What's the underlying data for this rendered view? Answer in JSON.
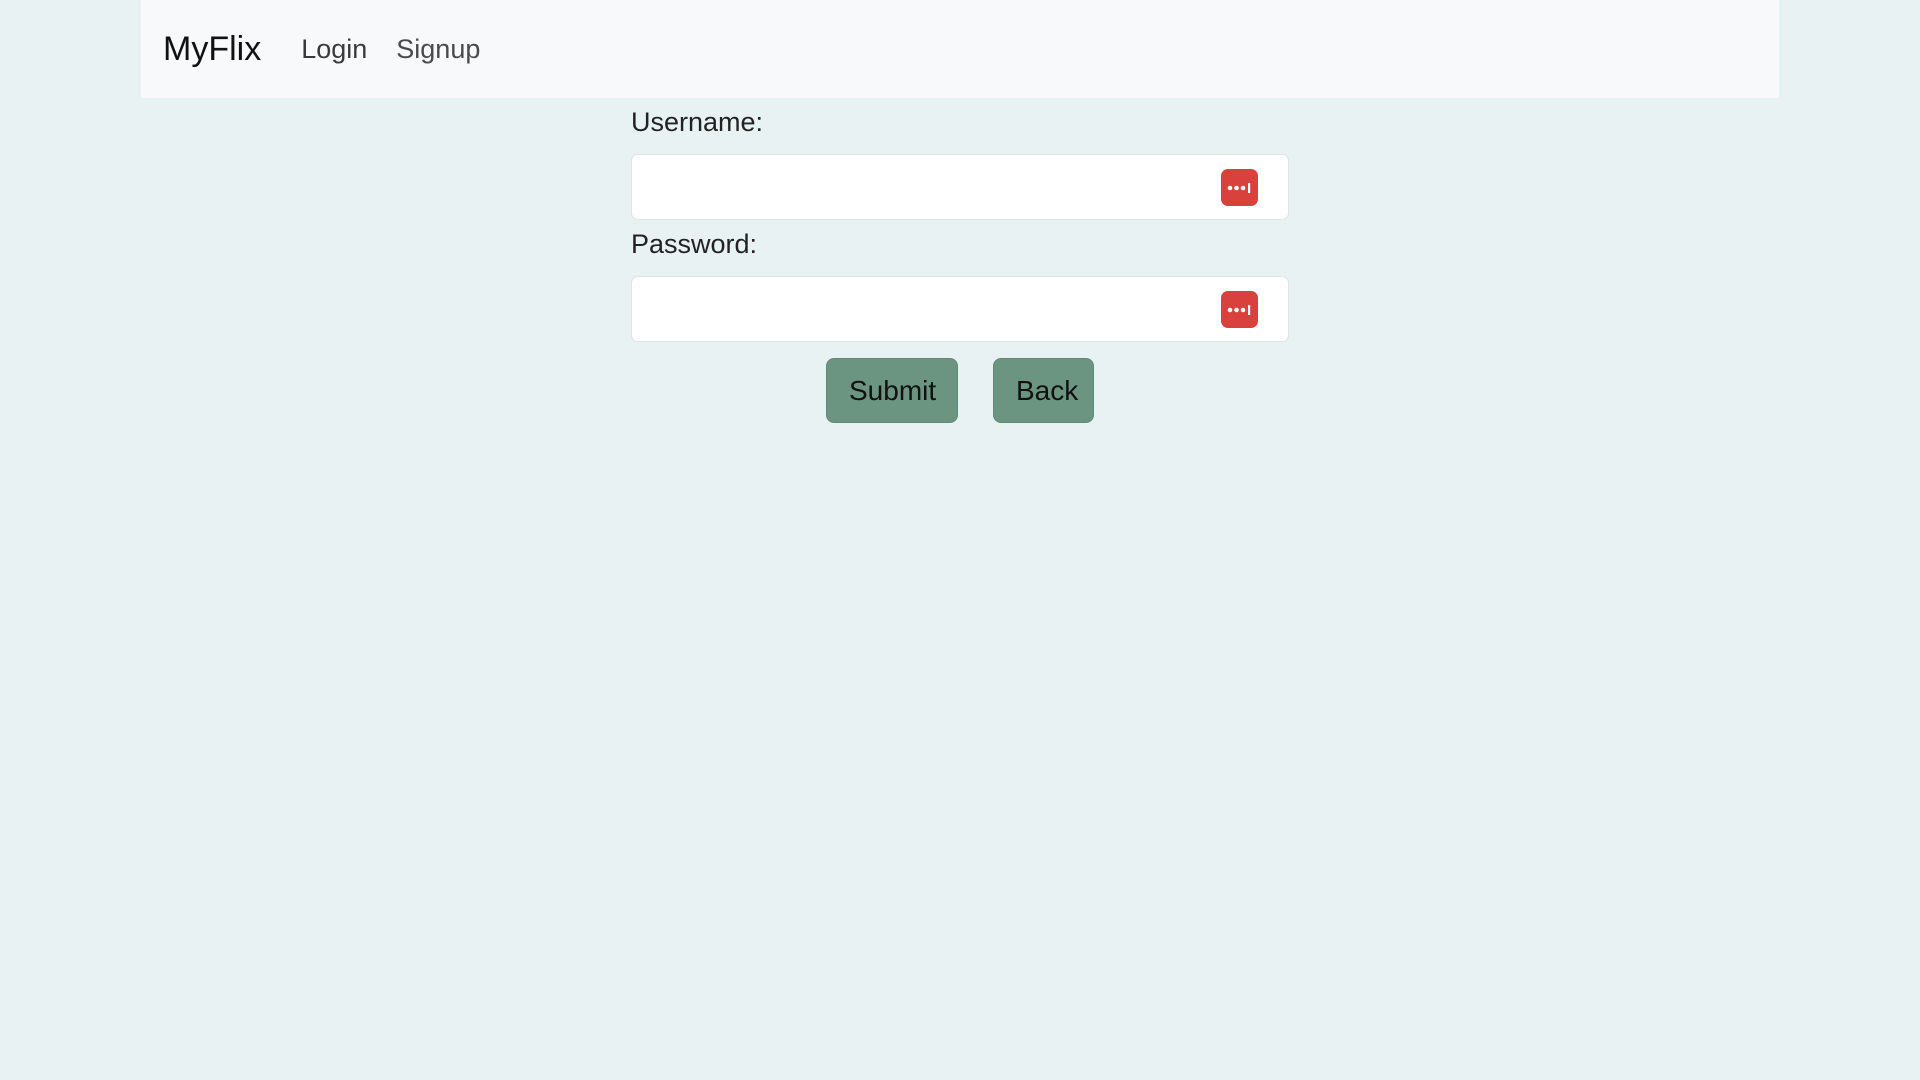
{
  "navbar": {
    "brand": "MyFlix",
    "links": [
      {
        "label": "Login"
      },
      {
        "label": "Signup"
      }
    ]
  },
  "form": {
    "username": {
      "label": "Username:",
      "value": "",
      "placeholder": ""
    },
    "password": {
      "label": "Password:",
      "value": "",
      "placeholder": ""
    },
    "password_manager_icon": "password-manager-icon",
    "submit_label": "Submit",
    "back_label": "Back"
  },
  "colors": {
    "page_background": "#e8f2f3",
    "navbar_background": "#f7f9fa",
    "button_background": "#6b9580",
    "password_manager_icon": "#d8413c"
  }
}
